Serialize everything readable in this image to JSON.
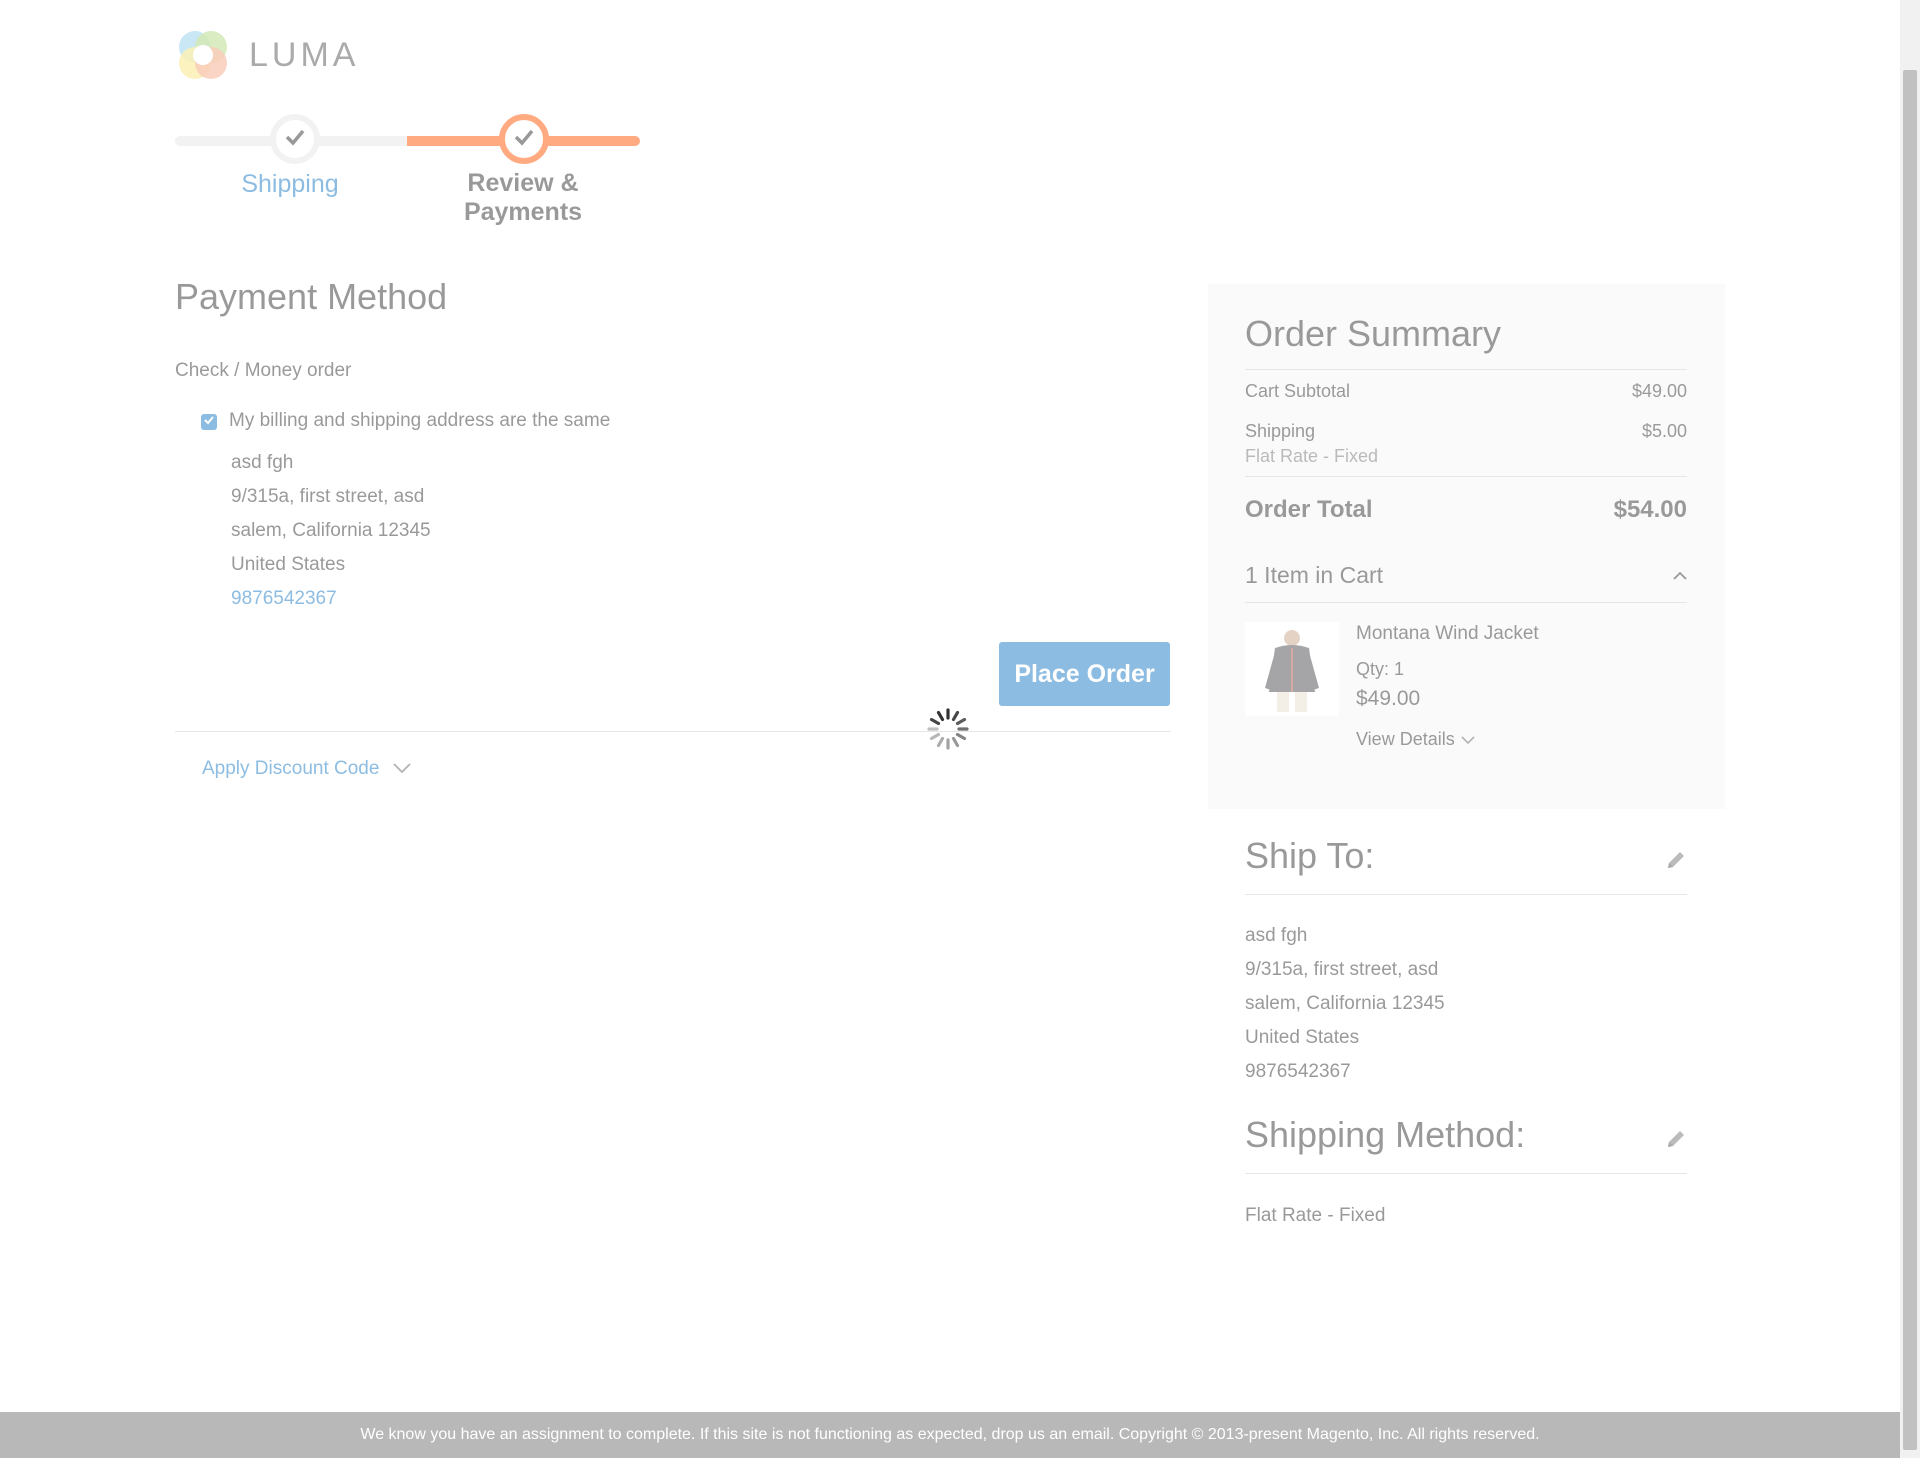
{
  "brand": {
    "name": "LUMA"
  },
  "progress": {
    "steps": [
      {
        "label": "Shipping",
        "state": "complete"
      },
      {
        "label": "Review & Payments",
        "state": "active"
      }
    ]
  },
  "payment": {
    "title": "Payment Method",
    "method": "Check / Money order",
    "same_address_label": "My billing and shipping address are the same",
    "same_address_checked": true,
    "address": {
      "name": "asd fgh",
      "street": "9/315a, first street, asd",
      "city_line": "salem, California 12345",
      "country": "United States",
      "phone": "9876542367"
    },
    "place_order_label": "Place Order"
  },
  "discount": {
    "label": "Apply Discount Code"
  },
  "summary": {
    "title": "Order Summary",
    "subtotal_label": "Cart Subtotal",
    "subtotal_value": "$49.00",
    "shipping_label": "Shipping",
    "shipping_value": "$5.00",
    "shipping_method": "Flat Rate - Fixed",
    "total_label": "Order Total",
    "total_value": "$54.00",
    "items_count_label": "1 Item in Cart",
    "item": {
      "name": "Montana Wind Jacket",
      "qty": "Qty: 1",
      "price": "$49.00",
      "details_label": "View Details"
    }
  },
  "ship_to": {
    "title": "Ship To:",
    "name": "asd fgh",
    "street": "9/315a, first street, asd",
    "city_line": "salem, California 12345",
    "country": "United States",
    "phone": "9876542367"
  },
  "shipping_method": {
    "title": "Shipping Method:",
    "value": "Flat Rate - Fixed"
  },
  "footer": {
    "text": "We know you have an assignment to complete. If this site is not functioning as expected, drop us an email. Copyright © 2013-present Magento, Inc. All rights reserved."
  },
  "icons": {
    "step_check": "check-icon",
    "edit": "pencil-icon",
    "expand": "chevron-down-icon",
    "collapse": "chevron-up-icon",
    "loading": "spinner-icon"
  },
  "colors": {
    "accent": "#1979c3",
    "progress": "#ff5501",
    "footer_bg": "#6e716e"
  }
}
